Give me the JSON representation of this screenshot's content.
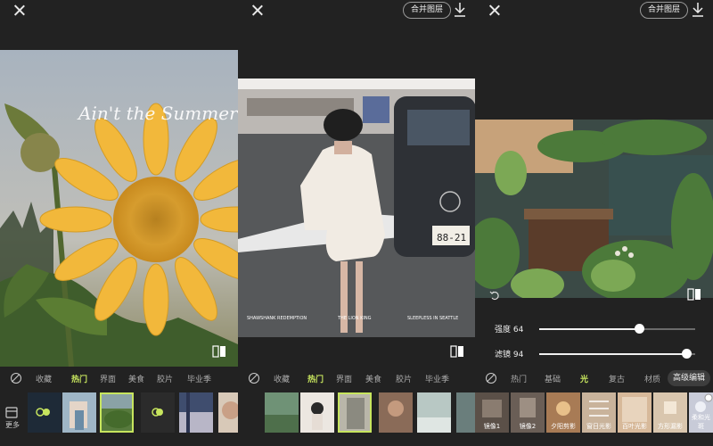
{
  "topbar": {
    "merge_label": "合并图层"
  },
  "panel1": {
    "photo_text": "Ain't the Summer ti...",
    "tabs": [
      "收藏",
      "热门",
      "界面",
      "美食",
      "胶片",
      "毕业季"
    ],
    "more_label": "更多"
  },
  "panel2": {
    "plate": "88-21",
    "caption_left": "SHAWSHANK REDEMPTION",
    "caption_mid": "THE LION KING",
    "caption_right": "SLEEPLESS IN SEATTLE",
    "tabs": [
      "收藏",
      "热门",
      "界面",
      "美食",
      "胶片",
      "毕业季"
    ]
  },
  "panel3": {
    "sliders": [
      {
        "label": "强度 64",
        "value": 64
      },
      {
        "label": "滤镜 94",
        "value": 94
      }
    ],
    "tabs": [
      "热门",
      "基础",
      "光",
      "复古",
      "材质",
      "高级编辑"
    ],
    "thumb_labels": [
      "镜像1",
      "镜像2",
      "夕阳剪影",
      "窗日光影",
      "百叶光影",
      "方形漏影",
      "柔和光斑"
    ]
  },
  "colors": {
    "accent": "#c7e55e",
    "background": "#222222"
  }
}
